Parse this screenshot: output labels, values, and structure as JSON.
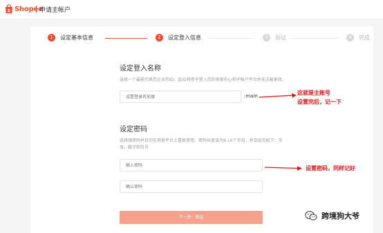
{
  "header": {
    "logo_text": "Shopee",
    "title": "申请主帐户",
    "brand_color": "#ee4d2d"
  },
  "steps": [
    {
      "number": "1",
      "label": "设定基本信息",
      "state": "done"
    },
    {
      "number": "2",
      "label": "设定登入信息",
      "state": "current"
    },
    {
      "number": "3",
      "label": "验证",
      "state": "pending"
    },
    {
      "number": "4",
      "label": "完成",
      "state": "pending"
    }
  ],
  "login_section": {
    "title": "设定登入名称",
    "hint": "选择一个最能代表您企业的ID，此ID将用于登入您的卖家中心和子帐户平台并无法被更改。",
    "username_placeholder": "设置登录名前缀",
    "username_suffix": ":main"
  },
  "password_section": {
    "title": "设定密码",
    "hint_line1": "选择强密码并且勿在其他平台上重复使用。密码长度该为8-16个字母，并且组合如下：字",
    "hint_line2": "母、数字和符号",
    "password_placeholder": "输入密码",
    "confirm_placeholder": "确认密码"
  },
  "next_button_label": "下一步：验证",
  "annotations": {
    "username_line1": "这就是主账号",
    "username_line2": "设置完后，记一下",
    "password": "设置密码，同样记好",
    "color": "#e0141a"
  },
  "watermark": {
    "text": "跨境狗大爷",
    "icon": "wechat-icon"
  }
}
